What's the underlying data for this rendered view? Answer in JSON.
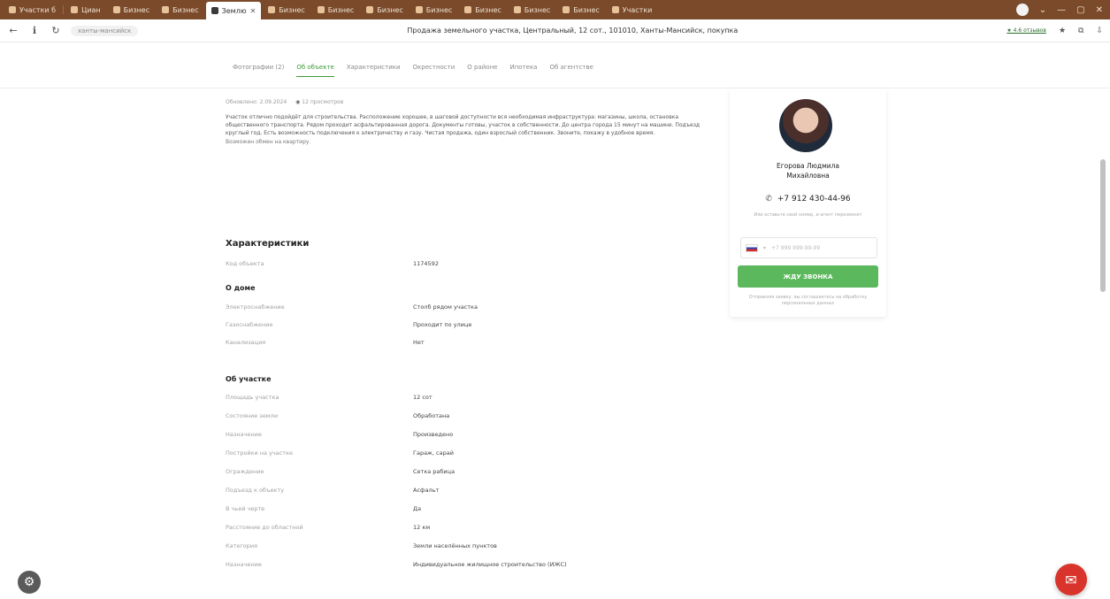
{
  "browser": {
    "tabs": [
      {
        "label": "Участки б"
      },
      {
        "label": "Циан"
      },
      {
        "label": "Бизнес"
      },
      {
        "label": "Бизнес"
      },
      {
        "label": "Землю",
        "active": true
      },
      {
        "label": "Бизнес"
      },
      {
        "label": "Бизнес"
      },
      {
        "label": "Бизнес"
      },
      {
        "label": "Бизнес"
      },
      {
        "label": "Бизнес"
      },
      {
        "label": "Бизнес"
      },
      {
        "label": "Бизнес"
      },
      {
        "label": "Участки"
      }
    ],
    "url": "ханты-мансийск",
    "page_title": "Продажа земельного участка, Центральный, 12 сот., 101010, Ханты-Мансийск, покупка",
    "rating": "★ 4.6 отзывов"
  },
  "anchor_nav": {
    "links": [
      "Фотографии (2)",
      "Об объекте",
      "Характеристики",
      "Окрестности",
      "О районе",
      "Ипотека",
      "Об агентстве"
    ],
    "active_index": 1
  },
  "listing": {
    "date": "Обновлено: 2.09.2024",
    "views": "12 просмотров",
    "description": "Участок отлично подойдёт для строительства. Расположение хорошее, в шаговой доступности вся необходимая инфраструктура: магазины, школа, остановка общественного транспорта. Рядом проходит асфальтированная дорога. Документы готовы, участок в собственности. До центра города 15 минут на машине. Подъезд круглый год. Есть возможность подключения к электричеству и газу. Чистая продажа, один взрослый собственник. Звоните, покажу в удобное время.",
    "note": "Возможен обмен на квартиру."
  },
  "characteristics": {
    "title": "Характеристики",
    "top_rows": [
      {
        "key": "Код объекта",
        "value": "1174592"
      }
    ],
    "house_title": "О доме",
    "house_rows": [
      {
        "key": "Электроснабжение",
        "value": "Столб рядом участка"
      },
      {
        "key": "Газоснабжение",
        "value": "Проходит по улице"
      },
      {
        "key": "Канализация",
        "value": "Нет"
      }
    ],
    "plot_title": "Об участке",
    "plot_rows": [
      {
        "key": "Площадь участка",
        "value": "12 сот"
      },
      {
        "key": "Состояние земли",
        "value": "Обработана"
      },
      {
        "key": "Назначение",
        "value": "Произведено"
      },
      {
        "key": "Постройки на участке",
        "value": "Гараж, сарай"
      },
      {
        "key": "Ограждение",
        "value": "Сетка рабица"
      },
      {
        "key": "Подъезд к объекту",
        "value": "Асфальт"
      },
      {
        "key": "В чьей черте",
        "value": "Да"
      },
      {
        "key": "Расстояние до областной",
        "value": "12 км"
      },
      {
        "key": "Категория",
        "value": "Земли населённых пунктов"
      },
      {
        "key": "Назначение",
        "value": "Индивидуальное жилищное строительство (ИЖС)"
      }
    ]
  },
  "agent": {
    "name_line1": "Егорова Людмила",
    "name_line2": "Михайловна",
    "phone": "+7 912 430-44-96",
    "hint": "Или оставьте свой номер, и агент перезвонит",
    "phone_placeholder": "+7 999 999-99-99",
    "call_button": "ЖДУ ЗВОНКА",
    "legal": "Отправляя заявку, вы соглашаетесь на обработку персональных данных"
  },
  "colors": {
    "tabstrip": "#7a4a2a",
    "accent_green": "#5cb85c",
    "chat": "#d9342b"
  }
}
